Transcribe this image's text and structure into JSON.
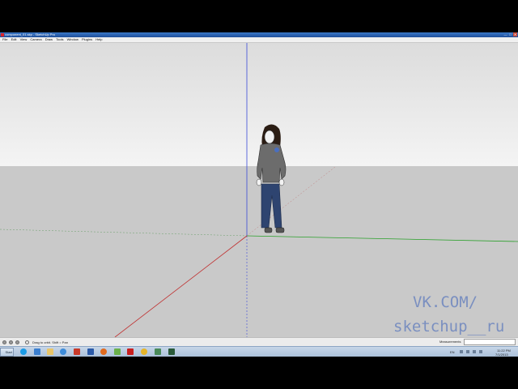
{
  "window": {
    "title": "component_01.skp - SketchUp Pro",
    "controls": [
      "—",
      "□",
      "✕"
    ]
  },
  "menu": [
    "File",
    "Edit",
    "View",
    "Camera",
    "Draw",
    "Tools",
    "Window",
    "Plugins",
    "Help"
  ],
  "statusbar": {
    "hint": "Drag to orbit.  Shift = Pan",
    "measurements_label": "Measurements",
    "measurements_value": ""
  },
  "taskbar": {
    "start_label": "Start",
    "apps": [
      "skype-icon",
      "ie-icon",
      "explorer-icon",
      "media-player-icon",
      "sketchup-icon",
      "photoshop-icon",
      "firefox-icon",
      "notepad-icon",
      "filezilla-icon",
      "chrome-icon",
      "network-icon",
      "app-icon"
    ]
  },
  "tray": {
    "language": "EN",
    "time": "11:22 PM",
    "date": "7/1/2013"
  },
  "watermark": {
    "line1": "VK.COM/",
    "line2": "sketchup__ru"
  },
  "colors": {
    "sky_top": "#e8e8e8",
    "ground": "#c9c9c9",
    "axis_red": "#c03030",
    "axis_green": "#2aa02a",
    "axis_blue": "#3a4ad8",
    "watermark": "#7a8fc0"
  }
}
